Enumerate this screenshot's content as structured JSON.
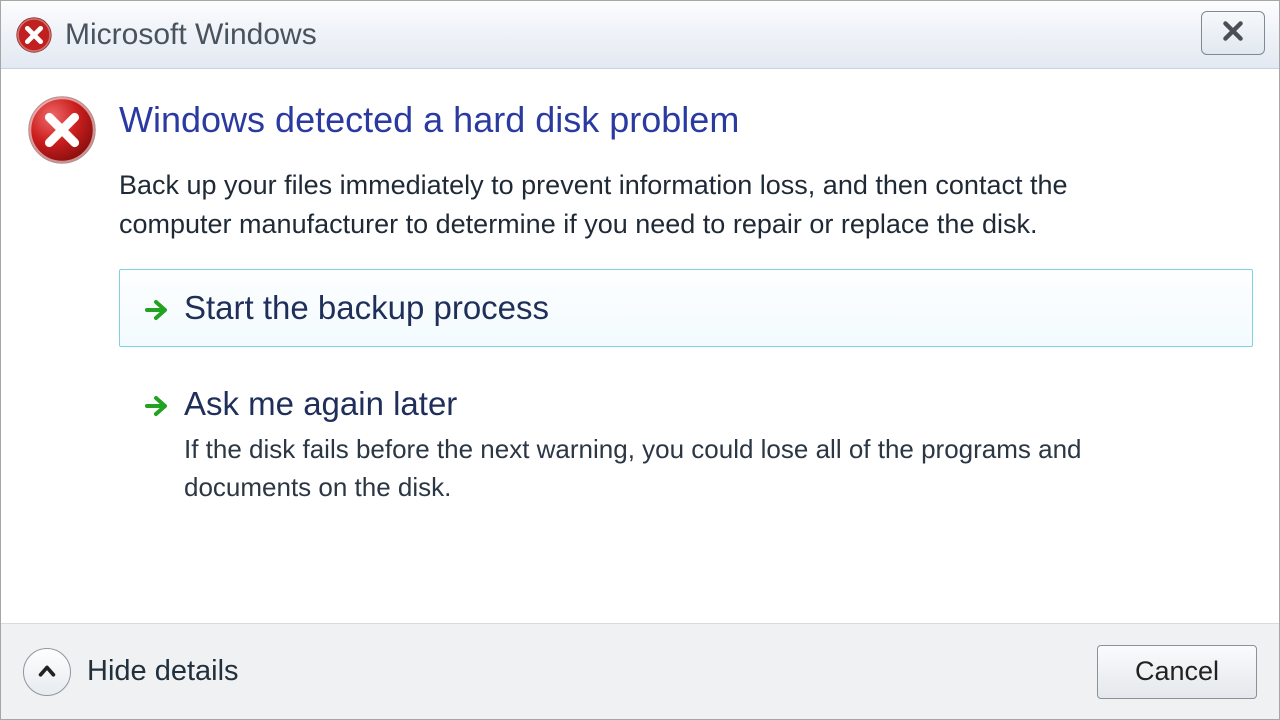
{
  "titlebar": {
    "title": "Microsoft Windows"
  },
  "main": {
    "headline": "Windows detected a hard disk problem",
    "description": "Back up your files immediately to prevent information loss, and then contact the computer manufacturer to determine if you need to repair or replace the disk."
  },
  "commands": [
    {
      "title": "Start the backup process",
      "subtitle": "",
      "selected": true
    },
    {
      "title": "Ask me again later",
      "subtitle": "If the disk fails before the next warning, you could lose all of the programs and documents on the disk.",
      "selected": false
    }
  ],
  "footer": {
    "details_label": "Hide details",
    "cancel_label": "Cancel"
  },
  "colors": {
    "headline": "#2b3aa0",
    "arrow": "#21a321",
    "error_icon": "#c02020"
  }
}
